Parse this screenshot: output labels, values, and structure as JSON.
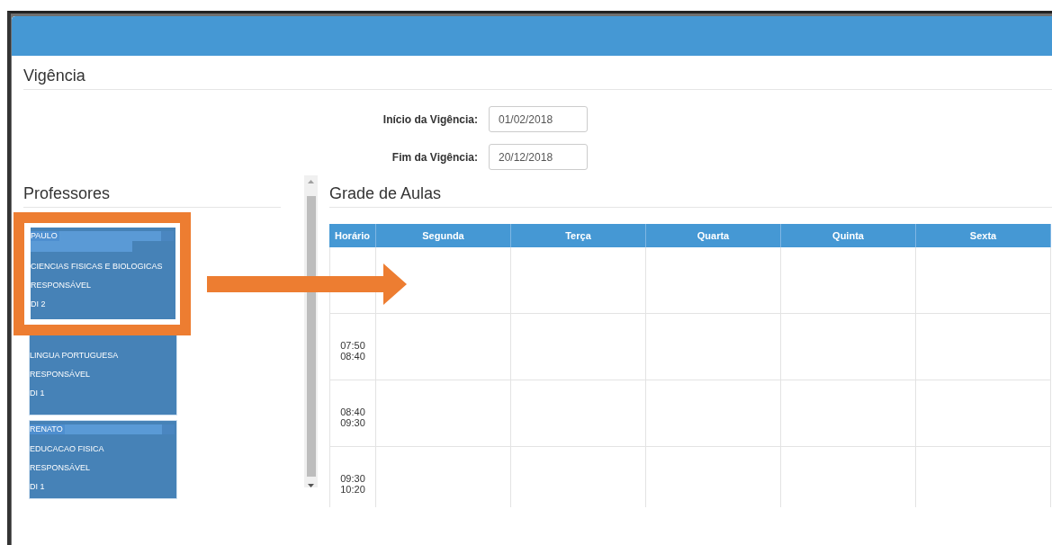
{
  "vigencia": {
    "title": "Vigência",
    "fields": [
      {
        "label": "Início da Vigência:",
        "value": "01/02/2018"
      },
      {
        "label": "Fim da Vigência:",
        "value": "20/12/2018"
      }
    ]
  },
  "professores": {
    "title": "Professores",
    "cards": [
      {
        "name": "PAULO",
        "selected": true,
        "lines": [
          "CIENCIAS FISICAS E BIOLOGICAS",
          "RESPONSÁVEL",
          "DI 2"
        ]
      },
      {
        "selected": false,
        "lines": [
          "LINGUA PORTUGUESA",
          "RESPONSÁVEL",
          "DI 1"
        ]
      },
      {
        "name": "RENATO",
        "selected": false,
        "lines": [
          "EDUCACAO FISICA",
          "RESPONSÁVEL",
          "DI 1"
        ]
      }
    ]
  },
  "grade": {
    "title": "Grade de Aulas",
    "columns": [
      "Horário",
      "Segunda",
      "Terça",
      "Quarta",
      "Quinta",
      "Sexta"
    ],
    "rows": [
      {},
      {
        "start": "07:50",
        "end": "08:40"
      },
      {
        "start": "08:40",
        "end": "09:30"
      },
      {
        "start": "09:30",
        "end": "10:20"
      }
    ]
  }
}
